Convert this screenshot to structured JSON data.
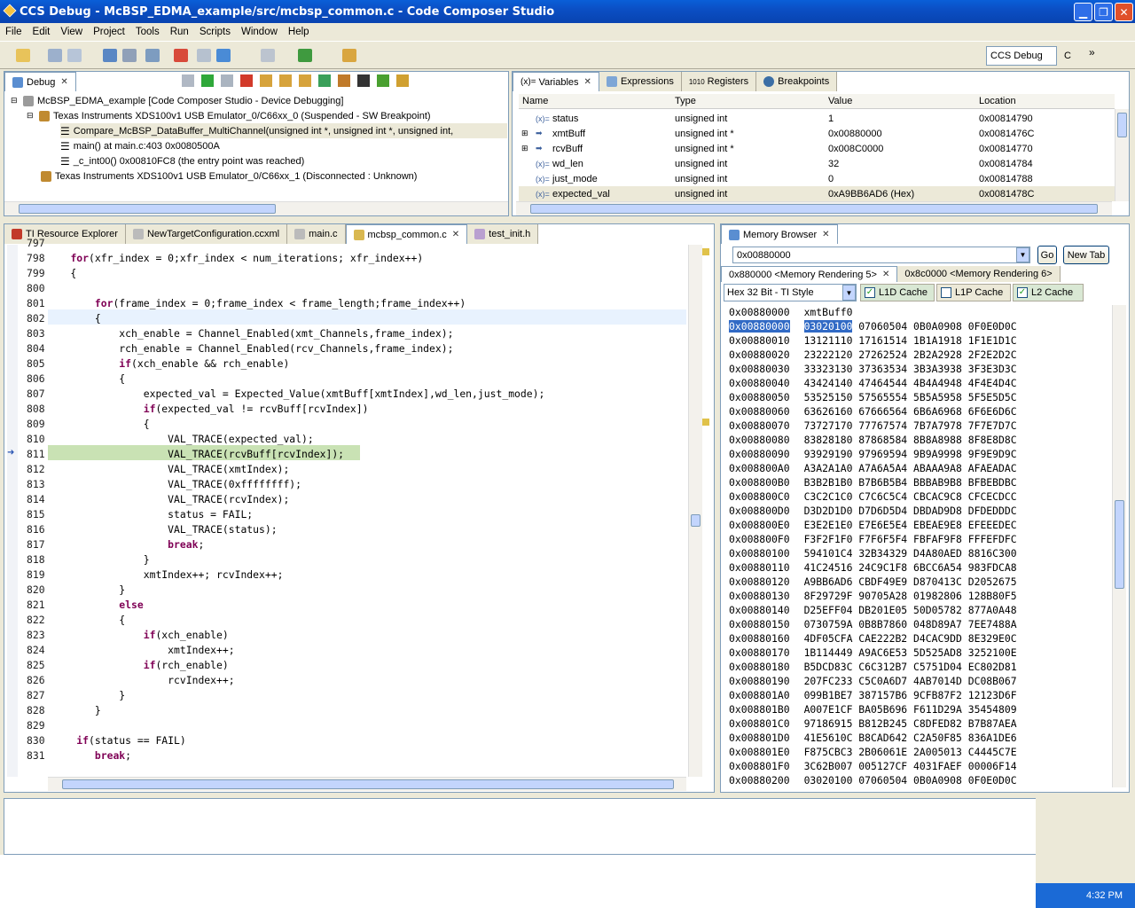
{
  "window": {
    "title": "CCS Debug - McBSP_EDMA_example/src/mcbsp_common.c - Code Composer Studio"
  },
  "menu": [
    "File",
    "Edit",
    "View",
    "Project",
    "Tools",
    "Run",
    "Scripts",
    "Window",
    "Help"
  ],
  "perspective": {
    "label": "CCS Debug",
    "other": "C"
  },
  "debug": {
    "tab": "Debug",
    "rows": [
      "McBSP_EDMA_example [Code Composer Studio - Device Debugging]",
      "Texas Instruments XDS100v1 USB Emulator_0/C66xx_0 (Suspended - SW Breakpoint)",
      "Compare_McBSP_DataBuffer_MultiChannel(unsigned int *, unsigned int *, unsigned int,",
      "main() at main.c:403 0x0080500A",
      "_c_int00() 0x00810FC8  (the entry point was reached)",
      "Texas Instruments XDS100v1 USB Emulator_0/C66xx_1 (Disconnected : Unknown)"
    ]
  },
  "varpanel": {
    "tabs": [
      "Variables",
      "Expressions",
      "Registers",
      "Breakpoints"
    ],
    "columns": [
      "Name",
      "Type",
      "Value",
      "Location"
    ],
    "rows": [
      {
        "name": "status",
        "type": "unsigned int",
        "value": "1",
        "loc": "0x00814790"
      },
      {
        "name": "xmtBuff",
        "type": "unsigned int *",
        "value": "0x00880000",
        "loc": "0x0081476C"
      },
      {
        "name": "rcvBuff",
        "type": "unsigned int *",
        "value": "0x008C0000",
        "loc": "0x00814770"
      },
      {
        "name": "wd_len",
        "type": "unsigned int",
        "value": "32",
        "loc": "0x00814784"
      },
      {
        "name": "just_mode",
        "type": "unsigned int",
        "value": "0",
        "loc": "0x00814788"
      },
      {
        "name": "expected_val",
        "type": "unsigned int",
        "value": "0xA9BB6AD6 (Hex)",
        "loc": "0x0081478C"
      }
    ]
  },
  "editor": {
    "tabs": [
      "TI Resource Explorer",
      "NewTargetConfiguration.ccxml",
      "main.c",
      "mcbsp_common.c",
      "test_init.h"
    ],
    "lines": [
      [
        "797",
        ""
      ],
      [
        "798",
        "    for(xfr_index = 0;xfr_index < num_iterations; xfr_index++)"
      ],
      [
        "799",
        "    {"
      ],
      [
        "800",
        ""
      ],
      [
        "801",
        "        for(frame_index = 0;frame_index < frame_length;frame_index++)"
      ],
      [
        "802",
        "        {"
      ],
      [
        "803",
        "            xch_enable = Channel_Enabled(xmt_Channels,frame_index);"
      ],
      [
        "804",
        "            rch_enable = Channel_Enabled(rcv_Channels,frame_index);"
      ],
      [
        "805",
        "            if(xch_enable && rch_enable)"
      ],
      [
        "806",
        "            {"
      ],
      [
        "807",
        "                expected_val = Expected_Value(xmtBuff[xmtIndex],wd_len,just_mode);"
      ],
      [
        "808",
        "                if(expected_val != rcvBuff[rcvIndex])"
      ],
      [
        "809",
        "                {"
      ],
      [
        "810",
        "                    VAL_TRACE(expected_val);"
      ],
      [
        "811",
        "                    VAL_TRACE(rcvBuff[rcvIndex]);"
      ],
      [
        "812",
        "                    VAL_TRACE(xmtIndex);"
      ],
      [
        "813",
        "                    VAL_TRACE(0xffffffff);"
      ],
      [
        "814",
        "                    VAL_TRACE(rcvIndex);"
      ],
      [
        "815",
        "                    status = FAIL;"
      ],
      [
        "816",
        "                    VAL_TRACE(status);"
      ],
      [
        "817",
        "                    break;"
      ],
      [
        "818",
        "                }"
      ],
      [
        "819",
        "                xmtIndex++; rcvIndex++;"
      ],
      [
        "820",
        "            }"
      ],
      [
        "821",
        "            else"
      ],
      [
        "822",
        "            {"
      ],
      [
        "823",
        "                if(xch_enable)"
      ],
      [
        "824",
        "                    xmtIndex++;"
      ],
      [
        "825",
        "                if(rch_enable)"
      ],
      [
        "826",
        "                    rcvIndex++;"
      ],
      [
        "827",
        "            }"
      ],
      [
        "828",
        "        }"
      ],
      [
        "829",
        ""
      ],
      [
        "830",
        "     if(status == FAIL)"
      ],
      [
        "831",
        "        break;"
      ]
    ]
  },
  "memory": {
    "tab": "Memory Browser",
    "address": "0x00880000",
    "go": "Go",
    "newtab": "New Tab",
    "renderings": [
      "0x880000 <Memory Rendering 5>",
      "0x8c0000 <Memory Rendering 6>"
    ],
    "format": "Hex 32 Bit - TI Style",
    "caches": [
      "L1D Cache",
      "L1P Cache",
      "L2 Cache"
    ],
    "header": [
      "0x00880000",
      "xmtBuff0"
    ],
    "rows": [
      [
        "0x00880000",
        "03020100 07060504 0B0A0908 0F0E0D0C"
      ],
      [
        "0x00880010",
        "13121110 17161514 1B1A1918 1F1E1D1C"
      ],
      [
        "0x00880020",
        "23222120 27262524 2B2A2928 2F2E2D2C"
      ],
      [
        "0x00880030",
        "33323130 37363534 3B3A3938 3F3E3D3C"
      ],
      [
        "0x00880040",
        "43424140 47464544 4B4A4948 4F4E4D4C"
      ],
      [
        "0x00880050",
        "53525150 57565554 5B5A5958 5F5E5D5C"
      ],
      [
        "0x00880060",
        "63626160 67666564 6B6A6968 6F6E6D6C"
      ],
      [
        "0x00880070",
        "73727170 77767574 7B7A7978 7F7E7D7C"
      ],
      [
        "0x00880080",
        "83828180 87868584 8B8A8988 8F8E8D8C"
      ],
      [
        "0x00880090",
        "93929190 97969594 9B9A9998 9F9E9D9C"
      ],
      [
        "0x008800A0",
        "A3A2A1A0 A7A6A5A4 ABAAA9A8 AFAEADAC"
      ],
      [
        "0x008800B0",
        "B3B2B1B0 B7B6B5B4 BBBAB9B8 BFBEBDBC"
      ],
      [
        "0x008800C0",
        "C3C2C1C0 C7C6C5C4 CBCAC9C8 CFCECDCC"
      ],
      [
        "0x008800D0",
        "D3D2D1D0 D7D6D5D4 DBDAD9D8 DFDEDDDC"
      ],
      [
        "0x008800E0",
        "E3E2E1E0 E7E6E5E4 EBEAE9E8 EFEEEDEC"
      ],
      [
        "0x008800F0",
        "F3F2F1F0 F7F6F5F4 FBFAF9F8 FFFEFDFC"
      ],
      [
        "0x00880100",
        "594101C4 32B34329 D4A80AED 8816C300"
      ],
      [
        "0x00880110",
        "41C24516 24C9C1F8 6BCC6A54 983FDCA8"
      ],
      [
        "0x00880120",
        "A9BB6AD6 CBDF49E9 D870413C D2052675"
      ],
      [
        "0x00880130",
        "8F29729F 90705A28 01982806 128B80F5"
      ],
      [
        "0x00880140",
        "D25EFF04 DB201E05 50D05782 877A0A48"
      ],
      [
        "0x00880150",
        "0730759A 0B8B7860 048D89A7 7EE7488A"
      ],
      [
        "0x00880160",
        "4DF05CFA CAE222B2 D4CAC9DD 8E329E0C"
      ],
      [
        "0x00880170",
        "1B114449 A9AC6E53 5D525AD8 3252100E"
      ],
      [
        "0x00880180",
        "B5DCD83C C6C312B7 C5751D04 EC802D81"
      ],
      [
        "0x00880190",
        "207FC233 C5C0A6D7 4AB7014D DC08B067"
      ],
      [
        "0x008801A0",
        "099B1BE7 387157B6 9CFB87F2 12123D6F"
      ],
      [
        "0x008801B0",
        "A007E1CF BA05B696 F611D29A 35454809"
      ],
      [
        "0x008801C0",
        "97186915 B812B245 C8DFED82 B7B87AEA"
      ],
      [
        "0x008801D0",
        "41E5610C B8CAD642 C2A50F85 836A1DE6"
      ],
      [
        "0x008801E0",
        "F875CBC3 2B06061E 2A005013 C4445C7E"
      ],
      [
        "0x008801F0",
        "3C62B007 005127CF 4031FAEF 00006F14"
      ],
      [
        "0x00880200",
        "03020100 07060504 0B0A0908 0F0E0D0C"
      ]
    ]
  },
  "taskbar": {
    "time": "4:32 PM"
  }
}
